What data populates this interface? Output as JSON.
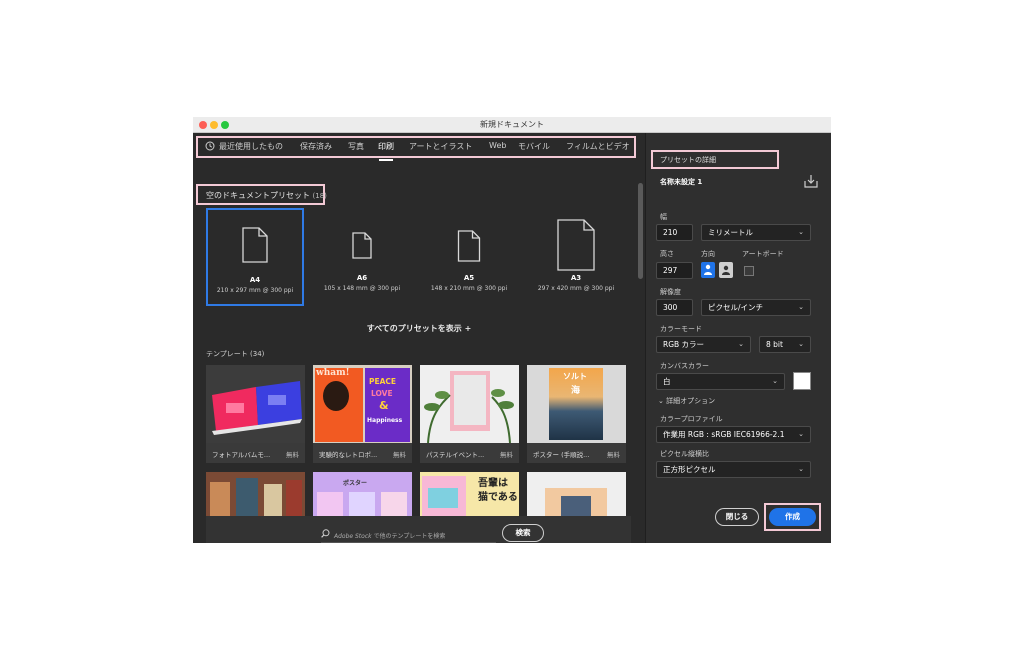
{
  "window": {
    "title": "新規ドキュメント"
  },
  "tabs": [
    {
      "label": "最近使用したもの"
    },
    {
      "label": "保存済み"
    },
    {
      "label": "写真"
    },
    {
      "label": "印刷"
    },
    {
      "label": "アートとイラスト"
    },
    {
      "label": "Web"
    },
    {
      "label": "モバイル"
    },
    {
      "label": "フィルムとビデオ"
    }
  ],
  "active_tab": "印刷",
  "presets": {
    "title": "空のドキュメントプリセット",
    "count": "(18)",
    "items": [
      {
        "name": "A4",
        "size": "210 x 297 mm @ 300 ppi"
      },
      {
        "name": "A6",
        "size": "105 x 148 mm @ 300 ppi"
      },
      {
        "name": "A5",
        "size": "148 x 210 mm @ 300 ppi"
      },
      {
        "name": "A3",
        "size": "297 x 420 mm @ 300 ppi"
      }
    ],
    "show_all": "すべてのプリセットを表示 +"
  },
  "templates": {
    "title": "テンプレート",
    "count": "(34)",
    "items": [
      {
        "label": "フォトアルバムモ...",
        "price": "無料"
      },
      {
        "label": "実験的なレトロポ...",
        "price": "無料"
      },
      {
        "label": "パステルイベント...",
        "price": "無料"
      },
      {
        "label": "ポスター (手順説...",
        "price": "無料"
      }
    ],
    "thumb_text": {
      "wham": "wham!",
      "peace": "PEACE",
      "love": "LOVE",
      "amp": "&",
      "happiness": "Happiness",
      "solt": "ソルト",
      "umi": "海",
      "poster": "ポスター",
      "wagahai1": "吾輩は",
      "wagahai2": "猫である"
    }
  },
  "search": {
    "placeholder_brand": "Adobe Stock",
    "placeholder_rest": " で他のテンプレートを検索",
    "button": "検索"
  },
  "details": {
    "title": "プリセットの詳細",
    "doc_name": "名称未設定 1",
    "width_label": "幅",
    "width_value": "210",
    "unit": "ミリメートル",
    "height_label": "高さ",
    "height_value": "297",
    "orientation_label": "方向",
    "artboard_label": "アートボード",
    "resolution_label": "解像度",
    "resolution_value": "300",
    "resolution_unit": "ピクセル/インチ",
    "color_mode_label": "カラーモード",
    "color_mode": "RGB カラー",
    "bit_depth": "8 bit",
    "canvas_color_label": "カンバスカラー",
    "canvas_color": "白",
    "advanced": "詳細オプション",
    "profile_label": "カラープロファイル",
    "profile": "作業用 RGB : sRGB IEC61966-2.1",
    "pixel_aspect_label": "ピクセル縦横比",
    "pixel_aspect": "正方形ピクセル",
    "close_button": "閉じる",
    "create_button": "作成"
  },
  "colors": {
    "accent": "#1f73e8",
    "highlight": "#f3c9d5",
    "selection": "#2f7ae5"
  }
}
